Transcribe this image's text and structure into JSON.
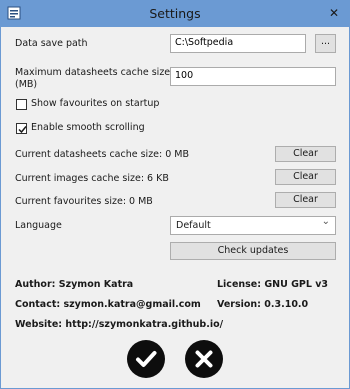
{
  "window": {
    "title": "Settings",
    "close_glyph": "✕"
  },
  "data_save_path": {
    "label": "Data save path",
    "value": "C:\\Softpedia",
    "browse_label": "..."
  },
  "cache_size": {
    "label_line1": "Maximum datasheets cache size",
    "label_line2": "(MB)",
    "value": "100"
  },
  "options": {
    "show_favourites": {
      "label": "Show favourites on startup",
      "checked": false
    },
    "smooth_scrolling": {
      "label": "Enable smooth scrolling",
      "checked": true
    }
  },
  "cache_info": {
    "datasheets": {
      "label": "Current datasheets cache size: 0 MB",
      "button": "Clear"
    },
    "images": {
      "label": "Current images cache size: 6 KB",
      "button": "Clear"
    },
    "favourites": {
      "label": "Current favourites size: 0 MB",
      "button": "Clear"
    }
  },
  "language": {
    "label": "Language",
    "selected": "Default",
    "chevron": "⌄"
  },
  "check_updates": {
    "label": "Check updates"
  },
  "about": {
    "author": "Author: Szymon Katra",
    "license": "License: GNU GPL v3",
    "contact": "Contact: szymon.katra@gmail.com",
    "version": "Version: 0.3.10.0",
    "website": "Website: http://szymonkatra.github.io/"
  },
  "actions": {
    "confirm_icon": "checkmark-icon",
    "cancel_icon": "cross-icon"
  },
  "colors": {
    "titlebar": "#6b9ad3",
    "window_bg": "#f0f0f0",
    "action_circle": "#0d0d0d"
  }
}
